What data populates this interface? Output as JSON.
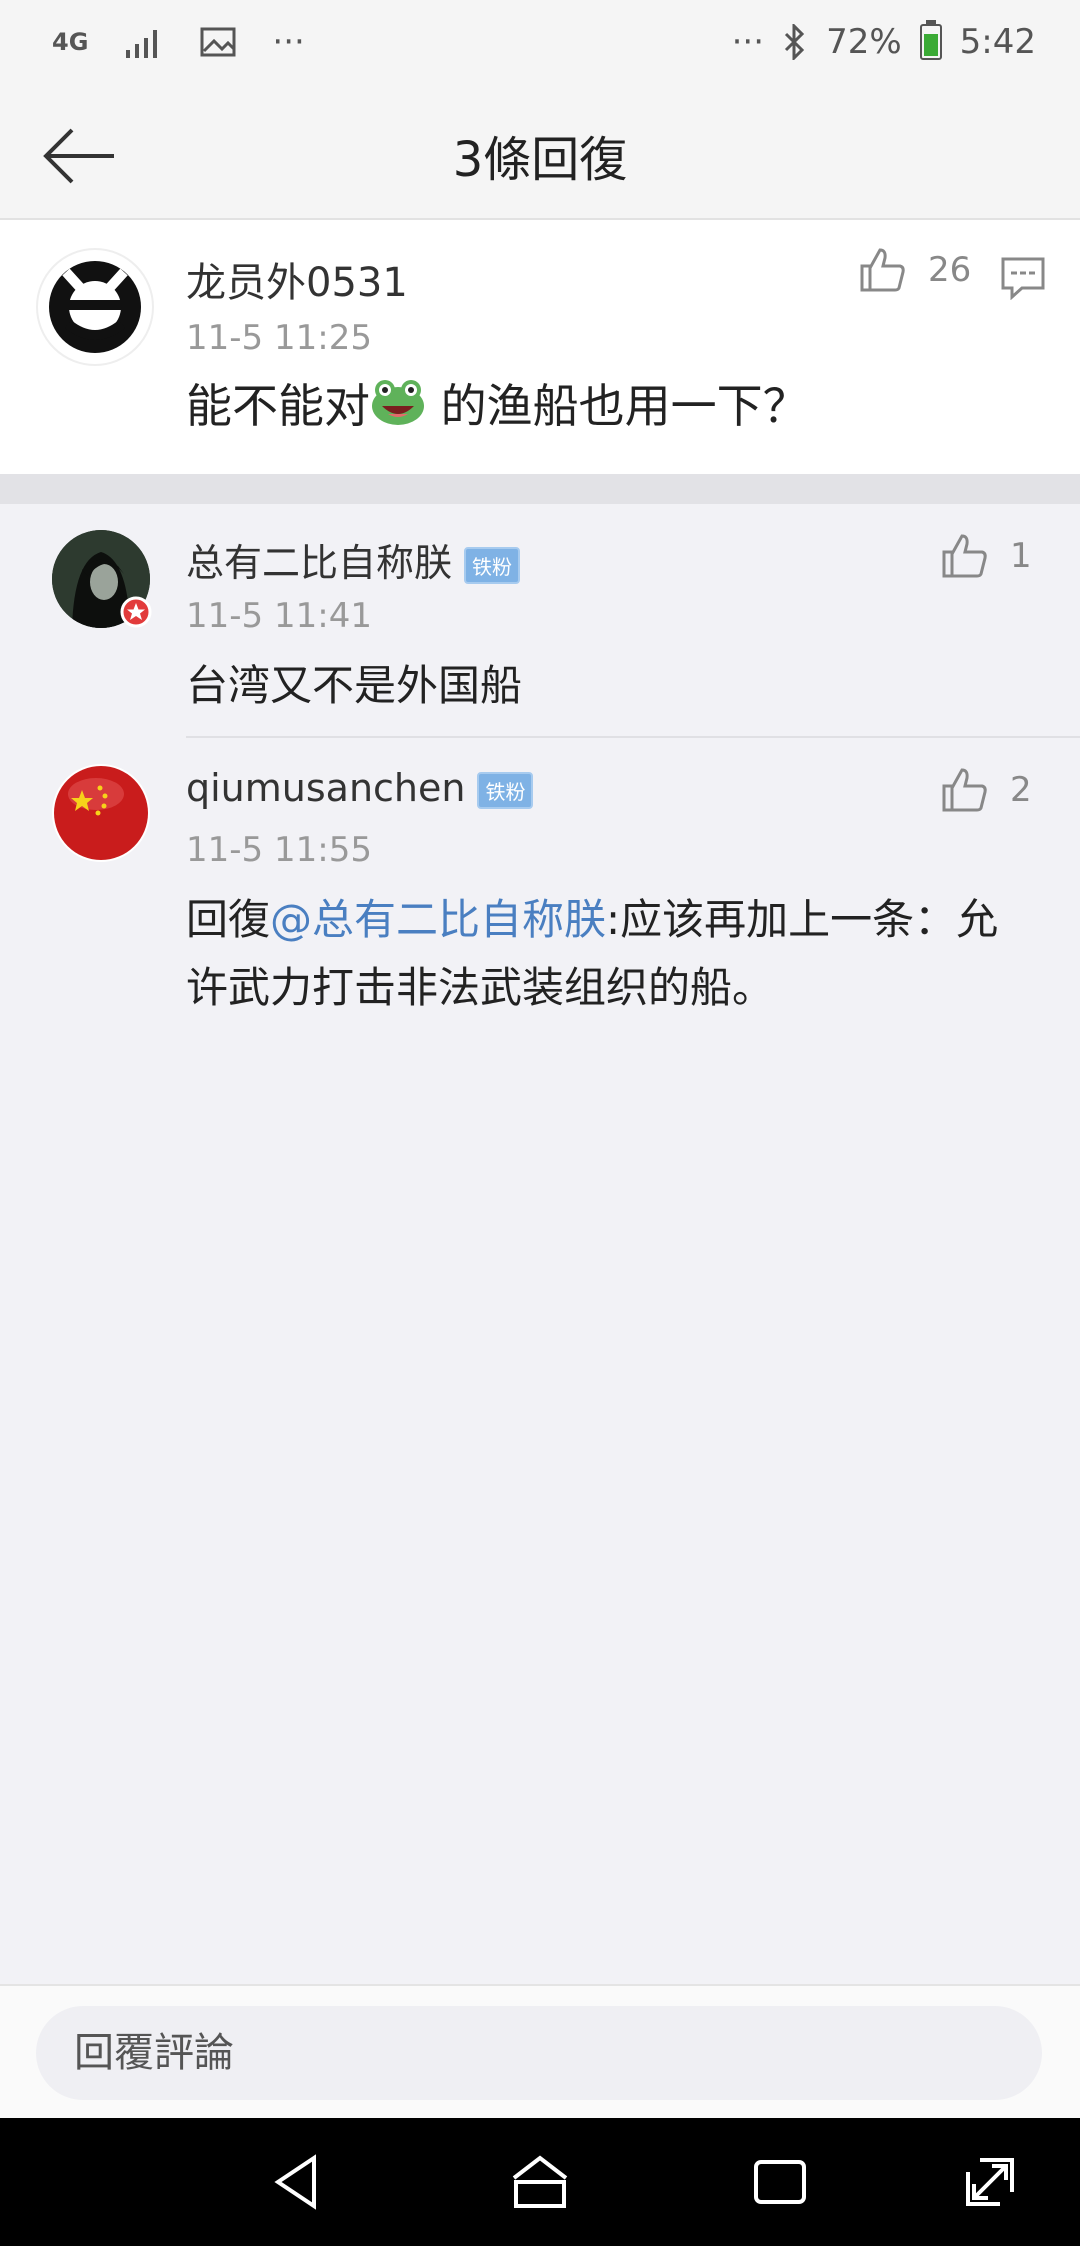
{
  "status_bar": {
    "network": "4G",
    "more_left": "···",
    "more_right": "···",
    "battery": "72%",
    "time": "5:42"
  },
  "header": {
    "title": "3條回復"
  },
  "main_comment": {
    "author": "龙员外0531",
    "time": "11-5 11:25",
    "content_before": "能不能对",
    "content_after": " 的渔船也用一下？",
    "likes": "26"
  },
  "replies": [
    {
      "author": "总有二比自称朕",
      "badge": "铁粉",
      "time": "11-5 11:41",
      "content": "台湾又不是外国船",
      "likes": "1"
    },
    {
      "author": "qiumusanchen",
      "badge": "铁粉",
      "time": "11-5 11:55",
      "prefix": "回復",
      "mention": "@总有二比自称朕",
      "content_line1": ":应该再加上一条：允",
      "content_line2": "许武力打击非法武装组织的船。",
      "likes": "2"
    }
  ],
  "bottom": {
    "reply_placeholder": "回覆評論"
  }
}
